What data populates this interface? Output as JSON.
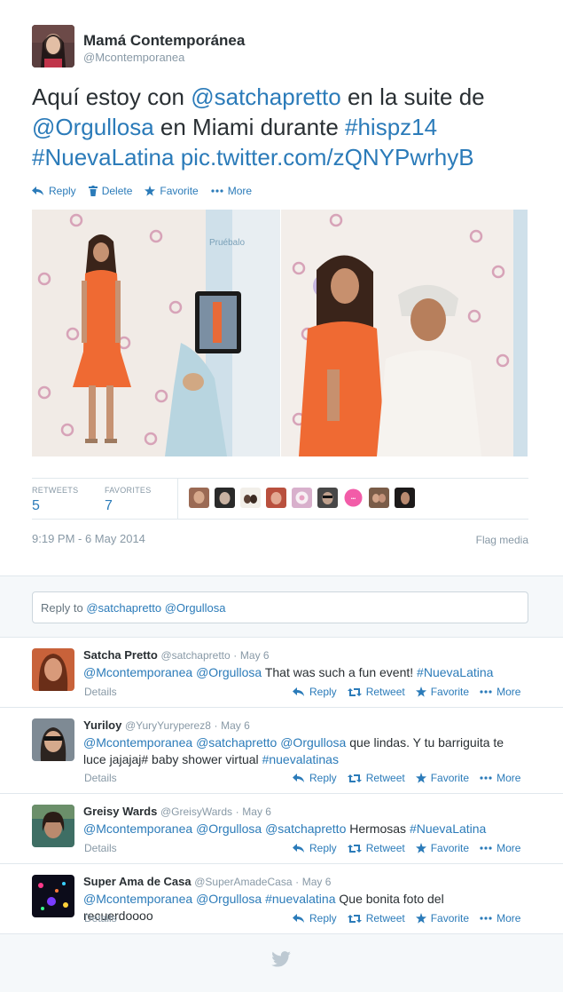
{
  "tweet": {
    "author_name": "Mamá Contemporánea",
    "author_handle": "@Mcontemporanea",
    "text_parts": [
      "Aquí estoy con ",
      "@satchapretto",
      " en la suite de ",
      "@Orgullosa",
      " en Miami durante ",
      "#hispz14",
      "#NuevaLatina",
      "pic.twitter.com/zQNYPwrhyB"
    ],
    "actions": {
      "reply": "Reply",
      "delete": "Delete",
      "favorite": "Favorite",
      "more": "More"
    },
    "stats": {
      "retweets_label": "RETWEETS",
      "retweets_value": "5",
      "favorites_label": "FAVORITES",
      "favorites_value": "7"
    },
    "timestamp": "9:19 PM - 6 May 2014",
    "flag_media": "Flag media"
  },
  "reply_box": {
    "placeholder_parts": [
      "Reply to ",
      "@satchapretto",
      " ",
      "@Orgullosa"
    ]
  },
  "replies": [
    {
      "name": "Satcha Pretto",
      "handle": "@satchapretto",
      "date": "May 6",
      "text_parts": [
        "@Mcontemporanea",
        " ",
        "@Orgullosa",
        " That was such a fun event! ",
        "#NuevaLatina"
      ],
      "details": "Details"
    },
    {
      "name": "Yuriloy",
      "handle": "@YuryYuryperez8",
      "date": "May 6",
      "text_parts": [
        "@Mcontemporanea",
        " ",
        "@satchapretto",
        " ",
        "@Orgullosa",
        " que lindas.  Y tu barriguita te luce jajajaj# baby shower virtual ",
        "#nuevalatinas"
      ],
      "details": "Details"
    },
    {
      "name": "Greisy Wards",
      "handle": "@GreisyWards",
      "date": "May 6",
      "text_parts": [
        "@Mcontemporanea",
        " ",
        "@Orgullosa",
        " ",
        "@satchapretto",
        " Hermosas ",
        "#NuevaLatina"
      ],
      "details": "Details"
    },
    {
      "name": "Super Ama de Casa",
      "handle": "@SuperAmadeCasa",
      "date": "May 6",
      "text_parts": [
        "@Mcontemporanea",
        " ",
        "@Orgullosa",
        " ",
        "#nuevalatina",
        " Que bonita foto del recuerdoooo"
      ],
      "details": "Details"
    }
  ],
  "reply_actions": {
    "reply": "Reply",
    "retweet": "Retweet",
    "favorite": "Favorite",
    "more": "More"
  },
  "meta_separator": "·",
  "colors": {
    "link": "#2b7bb9",
    "muted": "#8899a6",
    "text": "#292f33",
    "background_alt": "#f5f8fa",
    "border": "#e1e8ed"
  },
  "icons": [
    "reply-icon",
    "delete-icon",
    "favorite-icon",
    "more-icon",
    "retweet-icon",
    "twitter-bird-icon"
  ]
}
